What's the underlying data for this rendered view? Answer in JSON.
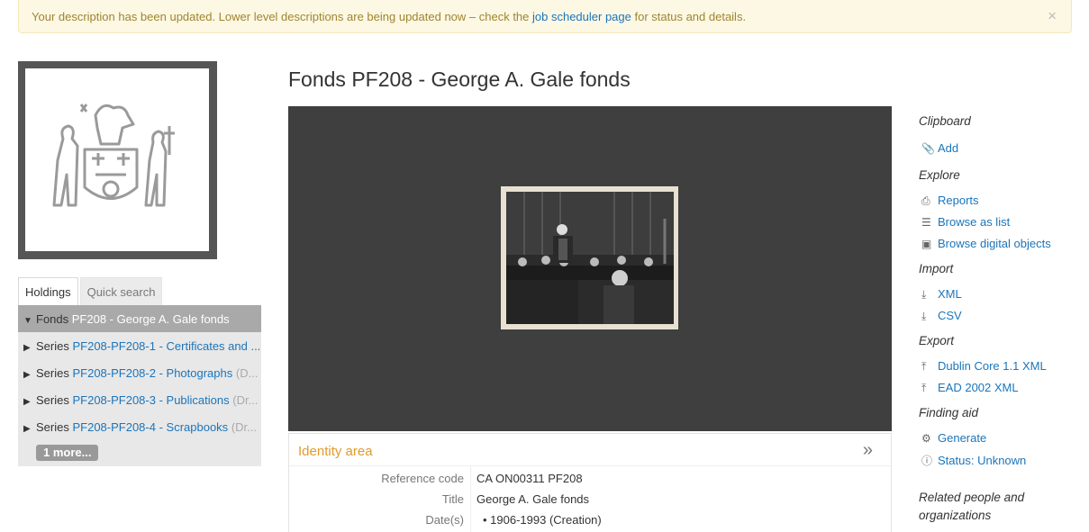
{
  "alert": {
    "text_before": "Your description has been updated. Lower level descriptions are being updated now – check the ",
    "link": "job scheduler page",
    "text_after": " for status and details.",
    "close": "×"
  },
  "page": {
    "title": "Fonds PF208 - George A. Gale fonds"
  },
  "tabs": {
    "holdings": "Holdings",
    "quick_search": "Quick search"
  },
  "tree": {
    "root": {
      "level": "Fonds",
      "title": "PF208 - George A. Gale fonds"
    },
    "items": [
      {
        "level": "Series",
        "title": "PF208-PF208-1 - Certificates and ...",
        "suffix": ""
      },
      {
        "level": "Series",
        "title": "PF208-PF208-2 - Photographs",
        "suffix": "(D..."
      },
      {
        "level": "Series",
        "title": "PF208-PF208-3 - Publications",
        "suffix": "(Dr..."
      },
      {
        "level": "Series",
        "title": "PF208-PF208-4 - Scrapbooks",
        "suffix": "(Dr..."
      }
    ],
    "more": "1 more..."
  },
  "identity": {
    "heading": "Identity area",
    "toggle": "»",
    "fields": [
      {
        "label": "Reference code",
        "value": "CA ON00311 PF208"
      },
      {
        "label": "Title",
        "value": "George A. Gale fonds"
      },
      {
        "label": "Date(s)",
        "value": "• 1906-1993 (Creation)"
      }
    ]
  },
  "sidebar": {
    "clipboard": {
      "heading": "Clipboard",
      "add": "Add"
    },
    "explore": {
      "heading": "Explore",
      "reports": "Reports",
      "browse_list": "Browse as list",
      "browse_digital": "Browse digital objects"
    },
    "import": {
      "heading": "Import",
      "xml": "XML",
      "csv": "CSV"
    },
    "export": {
      "heading": "Export",
      "dc": "Dublin Core 1.1 XML",
      "ead": "EAD 2002 XML"
    },
    "finding_aid": {
      "heading": "Finding aid",
      "generate": "Generate",
      "status": "Status: Unknown"
    },
    "related": {
      "heading_line1": "Related people and",
      "heading_line2": "organizations"
    }
  },
  "colors": {
    "link": "#1b75bb",
    "alert_bg": "#fcf8e3",
    "alert_text": "#a08430",
    "section_heading": "#e09b2b",
    "viewer_bg": "#3f3f3f"
  },
  "icons": [
    "paperclip-icon",
    "print-icon",
    "list-icon",
    "image-icon",
    "download-icon",
    "upload-icon",
    "cogs-icon",
    "info-icon",
    "caret-down-icon",
    "caret-right-icon",
    "close-icon",
    "double-chevron-icon"
  ]
}
